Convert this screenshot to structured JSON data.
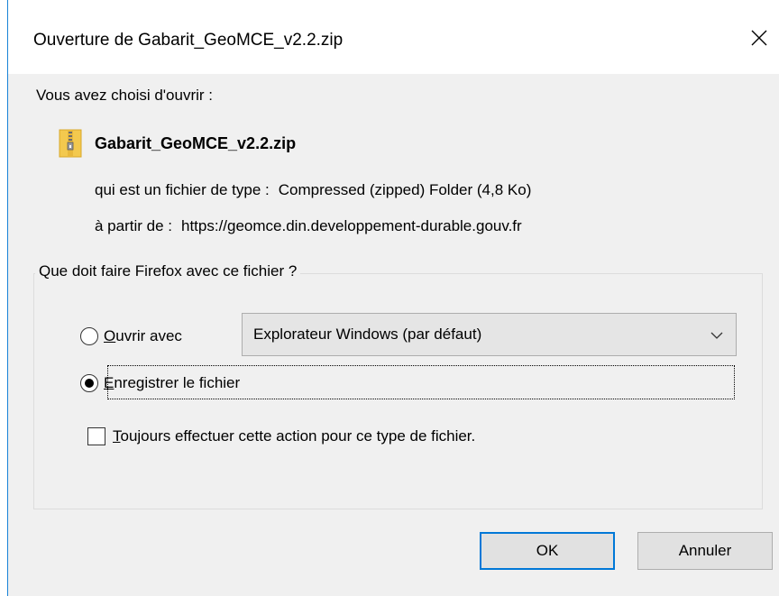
{
  "dialog": {
    "title": "Ouverture de Gabarit_GeoMCE_v2.2.zip",
    "close_icon": "close-icon"
  },
  "intro": "Vous avez choisi d'ouvrir :",
  "file": {
    "name": "Gabarit_GeoMCE_v2.2.zip",
    "icon": "zip-folder-icon",
    "type_label": "qui est un fichier de type :",
    "type_value": "Compressed (zipped) Folder (4,8 Ko)",
    "from_label": "à partir de :",
    "from_value": "https://geomce.din.developpement-durable.gouv.fr"
  },
  "action_group": {
    "legend": "Que doit faire Firefox avec ce fichier ?",
    "open_with": {
      "accel": "O",
      "rest": "uvrir avec",
      "checked": false,
      "app": "Explorateur Windows (par défaut)"
    },
    "save": {
      "accel": "E",
      "rest": "nregistrer le fichier",
      "checked": true
    },
    "always": {
      "accel": "T",
      "rest": "oujours effectuer cette action pour ce type de fichier.",
      "checked": false
    }
  },
  "buttons": {
    "ok": "OK",
    "cancel": "Annuler"
  },
  "colors": {
    "accent": "#0078d7",
    "window_border": "#1883d7",
    "dialog_bg": "#f0f0f0"
  }
}
